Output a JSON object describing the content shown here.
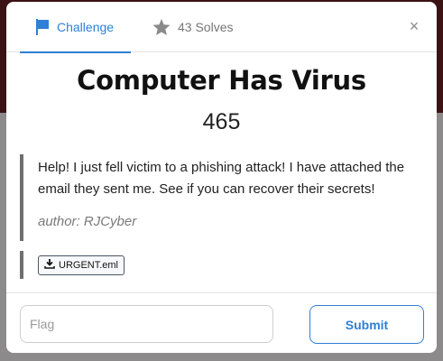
{
  "tabs": {
    "challenge_label": "Challenge",
    "solves_label": "43 Solves"
  },
  "close_label": "×",
  "challenge": {
    "title": "Computer Has Virus",
    "points": "465",
    "description": "Help! I just fell victim to a phishing attack! I have attached the email they sent me. See if you can recover their secrets!",
    "author": "author: RJCyber"
  },
  "files": [
    {
      "name": "URGENT.eml"
    }
  ],
  "form": {
    "flag_placeholder": "Flag",
    "submit_label": "Submit"
  },
  "colors": {
    "accent": "#2f7fd6",
    "backdrop_top": "#3b1215",
    "backdrop_bottom": "#8c8a8a"
  },
  "icons": {
    "challenge_tab": "flag-icon",
    "solves_tab": "star-icon",
    "close": "close-icon",
    "file": "download-icon"
  }
}
